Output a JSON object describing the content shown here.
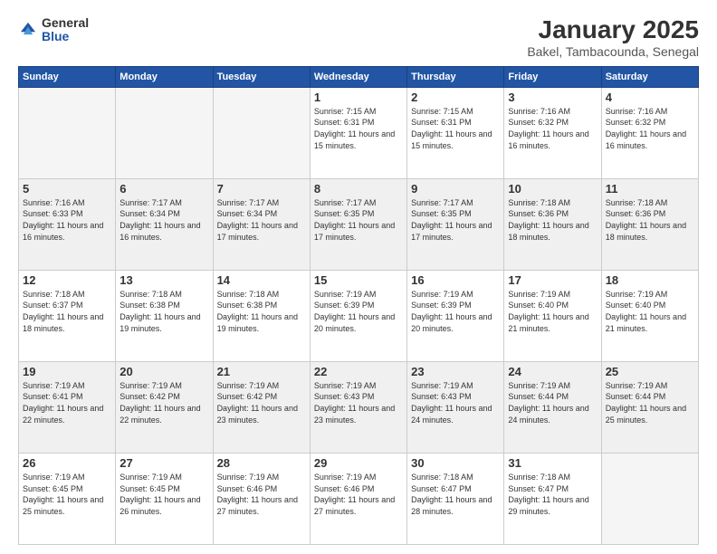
{
  "logo": {
    "general": "General",
    "blue": "Blue"
  },
  "header": {
    "month": "January 2025",
    "location": "Bakel, Tambacounda, Senegal"
  },
  "weekdays": [
    "Sunday",
    "Monday",
    "Tuesday",
    "Wednesday",
    "Thursday",
    "Friday",
    "Saturday"
  ],
  "weeks": [
    [
      {
        "day": "",
        "empty": true
      },
      {
        "day": "",
        "empty": true
      },
      {
        "day": "",
        "empty": true
      },
      {
        "day": "1",
        "sunrise": "7:15 AM",
        "sunset": "6:31 PM",
        "daylight": "11 hours and 15 minutes."
      },
      {
        "day": "2",
        "sunrise": "7:15 AM",
        "sunset": "6:31 PM",
        "daylight": "11 hours and 15 minutes."
      },
      {
        "day": "3",
        "sunrise": "7:16 AM",
        "sunset": "6:32 PM",
        "daylight": "11 hours and 16 minutes."
      },
      {
        "day": "4",
        "sunrise": "7:16 AM",
        "sunset": "6:32 PM",
        "daylight": "11 hours and 16 minutes."
      }
    ],
    [
      {
        "day": "5",
        "sunrise": "7:16 AM",
        "sunset": "6:33 PM",
        "daylight": "11 hours and 16 minutes."
      },
      {
        "day": "6",
        "sunrise": "7:17 AM",
        "sunset": "6:34 PM",
        "daylight": "11 hours and 16 minutes."
      },
      {
        "day": "7",
        "sunrise": "7:17 AM",
        "sunset": "6:34 PM",
        "daylight": "11 hours and 17 minutes."
      },
      {
        "day": "8",
        "sunrise": "7:17 AM",
        "sunset": "6:35 PM",
        "daylight": "11 hours and 17 minutes."
      },
      {
        "day": "9",
        "sunrise": "7:17 AM",
        "sunset": "6:35 PM",
        "daylight": "11 hours and 17 minutes."
      },
      {
        "day": "10",
        "sunrise": "7:18 AM",
        "sunset": "6:36 PM",
        "daylight": "11 hours and 18 minutes."
      },
      {
        "day": "11",
        "sunrise": "7:18 AM",
        "sunset": "6:36 PM",
        "daylight": "11 hours and 18 minutes."
      }
    ],
    [
      {
        "day": "12",
        "sunrise": "7:18 AM",
        "sunset": "6:37 PM",
        "daylight": "11 hours and 18 minutes."
      },
      {
        "day": "13",
        "sunrise": "7:18 AM",
        "sunset": "6:38 PM",
        "daylight": "11 hours and 19 minutes."
      },
      {
        "day": "14",
        "sunrise": "7:18 AM",
        "sunset": "6:38 PM",
        "daylight": "11 hours and 19 minutes."
      },
      {
        "day": "15",
        "sunrise": "7:19 AM",
        "sunset": "6:39 PM",
        "daylight": "11 hours and 20 minutes."
      },
      {
        "day": "16",
        "sunrise": "7:19 AM",
        "sunset": "6:39 PM",
        "daylight": "11 hours and 20 minutes."
      },
      {
        "day": "17",
        "sunrise": "7:19 AM",
        "sunset": "6:40 PM",
        "daylight": "11 hours and 21 minutes."
      },
      {
        "day": "18",
        "sunrise": "7:19 AM",
        "sunset": "6:40 PM",
        "daylight": "11 hours and 21 minutes."
      }
    ],
    [
      {
        "day": "19",
        "sunrise": "7:19 AM",
        "sunset": "6:41 PM",
        "daylight": "11 hours and 22 minutes."
      },
      {
        "day": "20",
        "sunrise": "7:19 AM",
        "sunset": "6:42 PM",
        "daylight": "11 hours and 22 minutes."
      },
      {
        "day": "21",
        "sunrise": "7:19 AM",
        "sunset": "6:42 PM",
        "daylight": "11 hours and 23 minutes."
      },
      {
        "day": "22",
        "sunrise": "7:19 AM",
        "sunset": "6:43 PM",
        "daylight": "11 hours and 23 minutes."
      },
      {
        "day": "23",
        "sunrise": "7:19 AM",
        "sunset": "6:43 PM",
        "daylight": "11 hours and 24 minutes."
      },
      {
        "day": "24",
        "sunrise": "7:19 AM",
        "sunset": "6:44 PM",
        "daylight": "11 hours and 24 minutes."
      },
      {
        "day": "25",
        "sunrise": "7:19 AM",
        "sunset": "6:44 PM",
        "daylight": "11 hours and 25 minutes."
      }
    ],
    [
      {
        "day": "26",
        "sunrise": "7:19 AM",
        "sunset": "6:45 PM",
        "daylight": "11 hours and 25 minutes."
      },
      {
        "day": "27",
        "sunrise": "7:19 AM",
        "sunset": "6:45 PM",
        "daylight": "11 hours and 26 minutes."
      },
      {
        "day": "28",
        "sunrise": "7:19 AM",
        "sunset": "6:46 PM",
        "daylight": "11 hours and 27 minutes."
      },
      {
        "day": "29",
        "sunrise": "7:19 AM",
        "sunset": "6:46 PM",
        "daylight": "11 hours and 27 minutes."
      },
      {
        "day": "30",
        "sunrise": "7:18 AM",
        "sunset": "6:47 PM",
        "daylight": "11 hours and 28 minutes."
      },
      {
        "day": "31",
        "sunrise": "7:18 AM",
        "sunset": "6:47 PM",
        "daylight": "11 hours and 29 minutes."
      },
      {
        "day": "",
        "empty": true
      }
    ]
  ],
  "labels": {
    "sunrise": "Sunrise:",
    "sunset": "Sunset:",
    "daylight": "Daylight:"
  }
}
